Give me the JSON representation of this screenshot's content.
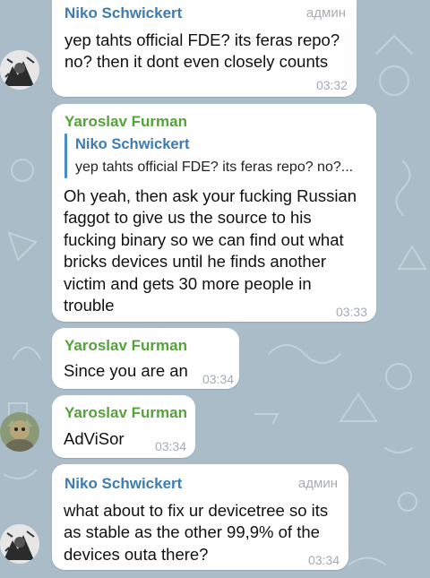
{
  "messages": [
    {
      "sender": "Niko Schwickert",
      "role": "админ",
      "lines": [
        "yep tahts official FDE?  its feras repo?",
        "no? then it dont even closely counts"
      ],
      "time": "03:32"
    },
    {
      "sender": "Yaroslav Furman",
      "reply": {
        "name": "Niko Schwickert",
        "text": "yep tahts official FDE?  its feras repo? no?..."
      },
      "lines": [
        "Oh yeah, then ask your fucking Russian",
        "faggot to give us the source to his",
        "fucking binary so we can find out what",
        "bricks devices until he finds another",
        "victim and gets 30 more people in",
        "trouble"
      ],
      "time": "03:33"
    },
    {
      "sender": "Yaroslav Furman",
      "lines": [
        "Since you are an"
      ],
      "time": "03:34"
    },
    {
      "sender": "Yaroslav Furman",
      "lines": [
        "AdViSor"
      ],
      "time": "03:34"
    },
    {
      "sender": "Niko Schwickert",
      "role": "админ",
      "lines": [
        "what about to fix ur devicetree so its",
        "as stable as the other 99,9% of the",
        "devices outa there?"
      ],
      "time": "03:34"
    }
  ],
  "colors": {
    "background": "#a9bcc8",
    "sender_niko": "#3c7cb4",
    "sender_yaroslav": "#55a23a"
  }
}
